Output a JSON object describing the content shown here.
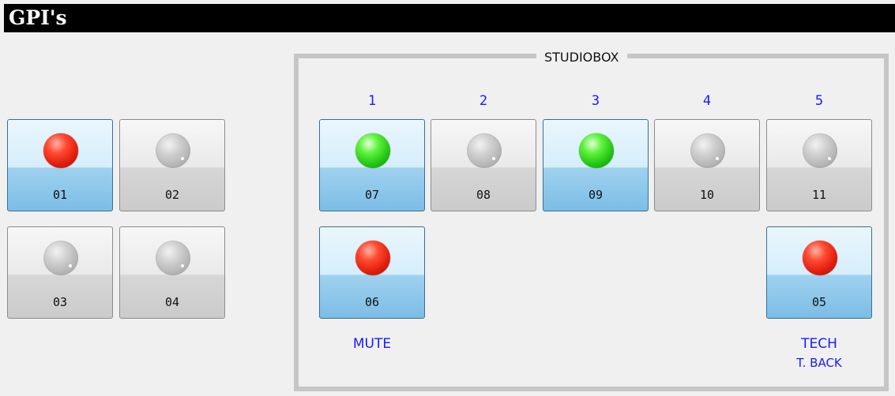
{
  "window": {
    "title": "GPI's"
  },
  "left_buttons": [
    {
      "label": "01",
      "led": "red",
      "active": true
    },
    {
      "label": "02",
      "led": "off",
      "active": false
    },
    {
      "label": "03",
      "led": "off",
      "active": false
    },
    {
      "label": "04",
      "led": "off",
      "active": false
    }
  ],
  "studiobox": {
    "title": "STUDIOBOX",
    "columns": [
      "1",
      "2",
      "3",
      "4",
      "5"
    ],
    "row1": [
      {
        "label": "07",
        "led": "green",
        "active": true
      },
      {
        "label": "08",
        "led": "off",
        "active": false
      },
      {
        "label": "09",
        "led": "green",
        "active": true
      },
      {
        "label": "10",
        "led": "off",
        "active": false
      },
      {
        "label": "11",
        "led": "off",
        "active": false
      }
    ],
    "mute": {
      "label": "06",
      "led": "red",
      "active": true,
      "caption": "MUTE"
    },
    "tech": {
      "label": "05",
      "led": "red",
      "active": true,
      "caption": "TECH",
      "subcaption": "T. BACK"
    }
  },
  "colors": {
    "accent_text": "#1a1aff",
    "led_red": "#e01d0e",
    "led_green": "#22c413",
    "active_button": "#9fd1ef"
  }
}
